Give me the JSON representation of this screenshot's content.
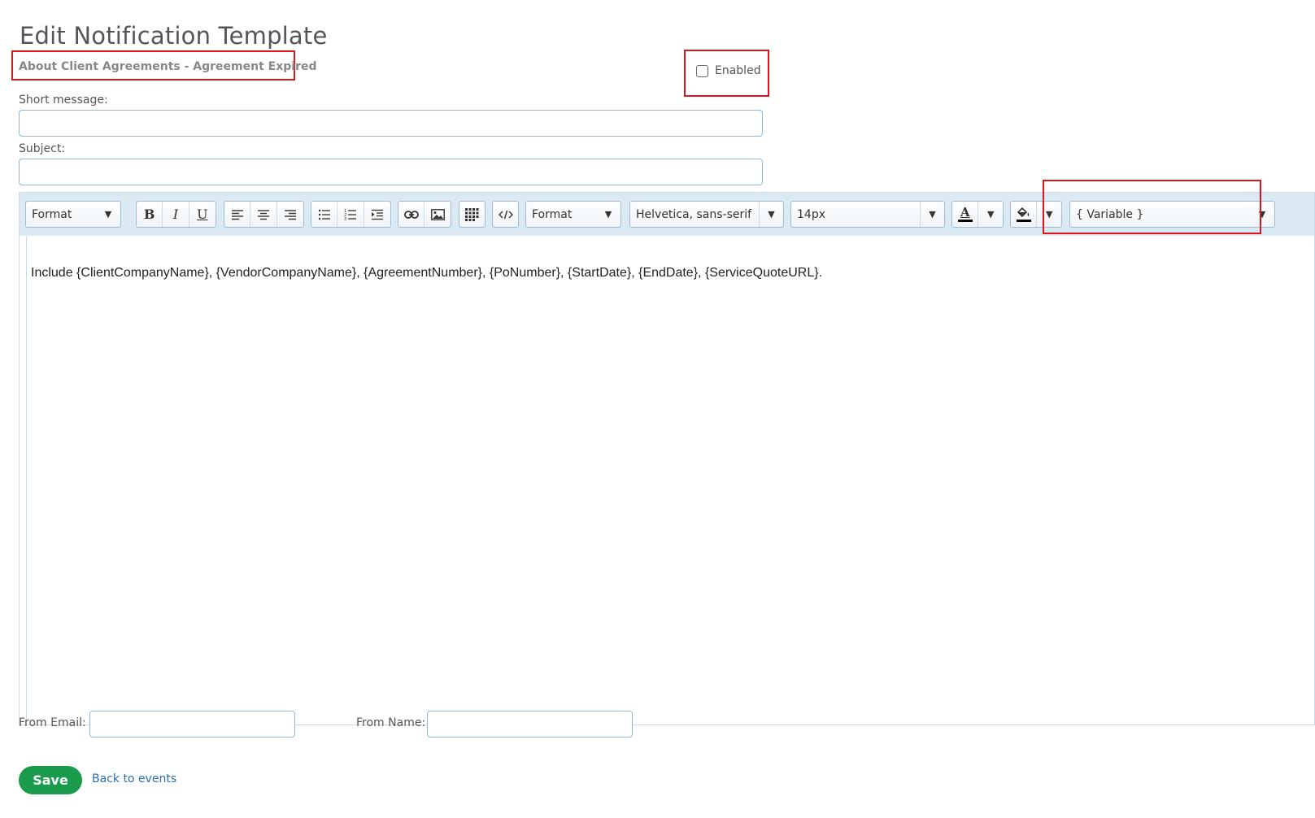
{
  "page": {
    "title": "Edit Notification Template",
    "event_name": "About Client Agreements - Agreement Expired",
    "enabled_label": "Enabled",
    "enabled_checked": false
  },
  "form": {
    "short_message_label": "Short message:",
    "short_message_value": "",
    "subject_label": "Subject:",
    "subject_value": "",
    "from_email_label": "From Email:",
    "from_email_value": "",
    "from_name_label": "From Name:",
    "from_name_value": ""
  },
  "toolbar": {
    "format1": "Format",
    "bold": "B",
    "italic": "I",
    "underline": "U",
    "format2": "Format",
    "font_family": "Helvetica, sans-serif",
    "font_size": "14px",
    "text_color_glyph": "A",
    "variable": "{ Variable }"
  },
  "editor": {
    "content": "Include {ClientCompanyName}, {VendorCompanyName}, {AgreementNumber}, {PoNumber}, {StartDate}, {EndDate}, {ServiceQuoteURL}."
  },
  "actions": {
    "save_label": "Save",
    "back_label": "Back to events"
  },
  "colors": {
    "highlight": "#e0141d",
    "save_button": "#1a9a4b",
    "link": "#2a6fa8",
    "toolbar_bg": "#dbe9f3"
  }
}
